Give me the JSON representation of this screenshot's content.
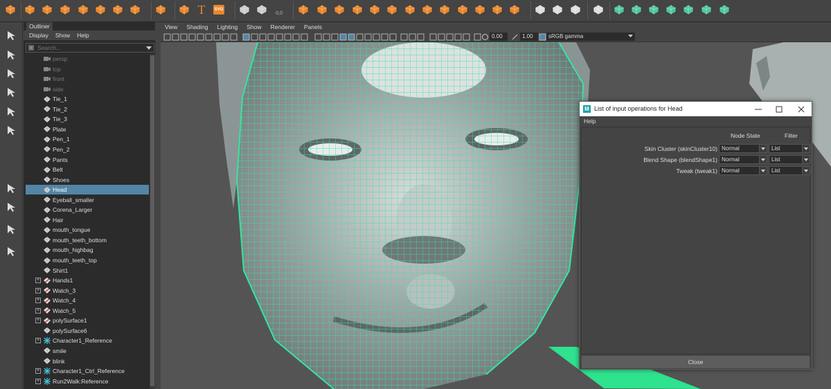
{
  "shelf": {
    "icons": [
      "toggle-icon",
      "sphere-icon",
      "cube-icon",
      "cylinder-icon",
      "cone-icon",
      "torus-icon",
      "plane-icon",
      "disc-icon",
      "soccer-ball-icon",
      "sparkle-icon",
      "text-icon",
      "svg-icon",
      "transform-icon",
      "snap-icon",
      "coordinates-icon",
      "sphere-brush-icon",
      "cube-group-icon",
      "mesh-icon",
      "mesh2-icon",
      "mesh3-icon",
      "mesh4-icon",
      "mesh5-icon",
      "mesh6-icon",
      "mesh7-icon",
      "mesh8-icon",
      "mesh9-icon",
      "mesh10-icon",
      "mesh11-icon",
      "pen-icon",
      "frame-icon",
      "pencil-icon",
      "bevel-icon",
      "extrude-icon",
      "bridge-icon",
      "combine-icon",
      "separate-icon",
      "merge-icon",
      "target-icon",
      "mirror-icon"
    ],
    "svg_label": "SVG",
    "text_label": "T",
    "coord_label": "0,0"
  },
  "toolbox": {
    "icons": [
      "select-icon",
      "lasso-icon",
      "paint-select-icon",
      "move-icon",
      "rotate-icon",
      "scale-icon",
      "show-manipulator-icon",
      "layout-single-icon",
      "layout-four-icon",
      "layout-two-icon",
      "outliner-layout-icon"
    ]
  },
  "outliner": {
    "tab": "Outliner",
    "menu": [
      "Display",
      "Show",
      "Help"
    ],
    "search_placeholder": "Search...",
    "items": [
      {
        "label": "persp",
        "type": "camera",
        "dim": true,
        "expander": false
      },
      {
        "label": "top",
        "type": "camera",
        "dim": true,
        "expander": false
      },
      {
        "label": "front",
        "type": "camera",
        "dim": true,
        "expander": false
      },
      {
        "label": "side",
        "type": "camera",
        "dim": true,
        "expander": false
      },
      {
        "label": "Tie_1",
        "type": "mesh",
        "dim": false,
        "expander": false
      },
      {
        "label": "Tie_2",
        "type": "mesh",
        "dim": false,
        "expander": false
      },
      {
        "label": "Tie_3",
        "type": "mesh",
        "dim": false,
        "expander": false
      },
      {
        "label": "Plate",
        "type": "mesh",
        "dim": false,
        "expander": false
      },
      {
        "label": "Pen_1",
        "type": "mesh",
        "dim": false,
        "expander": false
      },
      {
        "label": "Pen_2",
        "type": "mesh",
        "dim": false,
        "expander": false
      },
      {
        "label": "Pants",
        "type": "mesh",
        "dim": false,
        "expander": false
      },
      {
        "label": "Belt",
        "type": "mesh",
        "dim": false,
        "expander": false
      },
      {
        "label": "Shoes",
        "type": "mesh",
        "dim": false,
        "expander": false
      },
      {
        "label": "Head",
        "type": "mesh",
        "dim": false,
        "expander": false,
        "selected": true
      },
      {
        "label": "Eyeball_smaller",
        "type": "mesh",
        "dim": false,
        "expander": false
      },
      {
        "label": "Corena_Larger",
        "type": "mesh",
        "dim": false,
        "expander": false
      },
      {
        "label": "Hair",
        "type": "mesh",
        "dim": false,
        "expander": false
      },
      {
        "label": "mouth_tongue",
        "type": "mesh",
        "dim": false,
        "expander": false
      },
      {
        "label": "mouth_teeth_bottom",
        "type": "mesh",
        "dim": false,
        "expander": false
      },
      {
        "label": "mouth_highbag",
        "type": "mesh",
        "dim": false,
        "expander": false
      },
      {
        "label": "mouth_teeth_top",
        "type": "mesh",
        "dim": false,
        "expander": false
      },
      {
        "label": "Shirt1",
        "type": "mesh",
        "dim": false,
        "expander": false
      },
      {
        "label": "Hands1",
        "type": "deformed",
        "dim": false,
        "expander": true
      },
      {
        "label": "Watch_3",
        "type": "deformed",
        "dim": false,
        "expander": true
      },
      {
        "label": "Watch_4",
        "type": "deformed",
        "dim": false,
        "expander": true
      },
      {
        "label": "Watch_5",
        "type": "deformed",
        "dim": false,
        "expander": true
      },
      {
        "label": "polySurface1",
        "type": "deformed",
        "dim": false,
        "expander": true
      },
      {
        "label": "polySurface6",
        "type": "mesh",
        "dim": false,
        "expander": false
      },
      {
        "label": "Character1_Reference",
        "type": "joint",
        "dim": false,
        "expander": true
      },
      {
        "label": "smile",
        "type": "mesh",
        "dim": false,
        "expander": false
      },
      {
        "label": "blink",
        "type": "mesh",
        "dim": false,
        "expander": false
      },
      {
        "label": "Character1_Ctrl_Reference",
        "type": "joint",
        "dim": false,
        "expander": true
      },
      {
        "label": "Run2Walk:Reference",
        "type": "joint",
        "dim": false,
        "expander": true
      }
    ]
  },
  "viewport": {
    "menu": [
      "View",
      "Shading",
      "Lighting",
      "Show",
      "Renderer",
      "Panels"
    ],
    "exposure": "0.00",
    "gamma": "1.00",
    "color_space": "sRGB gamma"
  },
  "dialog": {
    "logo": "M",
    "title": "List of input operations for Head",
    "menu": "Help",
    "header_state": "Node State",
    "header_filter": "Filter",
    "operations": [
      {
        "label": "Skin Cluster (skinCluster10)",
        "state": "Normal",
        "filter": "List"
      },
      {
        "label": "Blend Shape (blendShape1)",
        "state": "Normal",
        "filter": "List"
      },
      {
        "label": "Tweak (tweak1)",
        "state": "Normal",
        "filter": "List"
      }
    ],
    "close_label": "Close"
  },
  "colors": {
    "selection": "#5285a6",
    "wireframe": "#35e5a0",
    "shelf_accent": "#e8852a",
    "shelf_green": "#4fc59a"
  }
}
